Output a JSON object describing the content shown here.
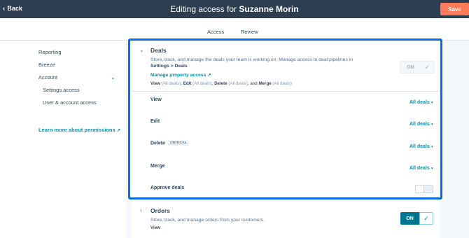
{
  "header": {
    "back_label": "Back",
    "title_prefix": "Editing access for",
    "title_user": "Suzanne Morin",
    "save_label": "Save"
  },
  "tabs": [
    {
      "label": "Access",
      "active": true
    },
    {
      "label": "Review",
      "active": false
    }
  ],
  "sidebar": {
    "items": [
      {
        "label": "Reporting"
      },
      {
        "label": "Breeze"
      },
      {
        "label": "Account"
      },
      {
        "label": "Settings access"
      },
      {
        "label": "User & account access"
      }
    ],
    "learn_more": "Learn more about permissions"
  },
  "deals": {
    "title": "Deals",
    "description": "Store, track, and manage the deals your team is working on. Manage access to deal pipelines in",
    "settings_path": "Settings > Deals",
    "manage_link": "Manage property access",
    "toggle_label": "ON",
    "summary": [
      {
        "name": "View",
        "scope": "(All deals)"
      },
      {
        "name": "Edit",
        "scope": "(All deals)"
      },
      {
        "name": "Delete",
        "scope": "(All deals)"
      },
      {
        "name": "Merge",
        "scope": "(All deals)"
      }
    ],
    "summary_joiner_and": "and",
    "permissions": [
      {
        "label": "View",
        "value": "All deals"
      },
      {
        "label": "Edit",
        "value": "All deals"
      },
      {
        "label": "Delete",
        "value": "All deals",
        "badge": "CRITICAL"
      },
      {
        "label": "Merge",
        "value": "All deals"
      }
    ],
    "approve_label": "Approve deals",
    "approve_enabled": false
  },
  "orders": {
    "title": "Orders",
    "description": "Store, track, and manage orders from your customers.",
    "summary_first": "View",
    "toggle_label": "ON"
  },
  "colors": {
    "header_bg": "#2d3e50",
    "save_button": "#ff7a59",
    "link": "#0091ae",
    "focus_ring": "#0a6cdd",
    "toggle_on": "#00758f"
  }
}
